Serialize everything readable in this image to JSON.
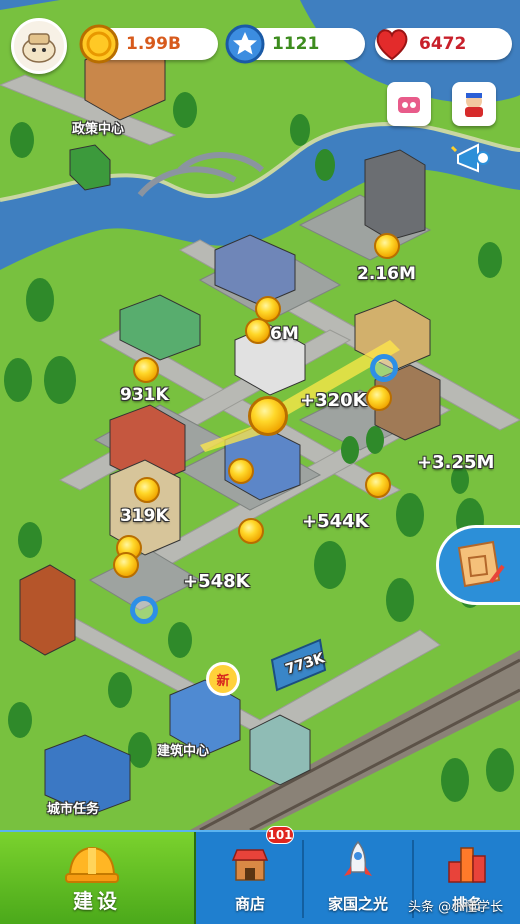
{
  "resources": {
    "gold": "1.99B",
    "stars": "1121",
    "hearts": "6472"
  },
  "map_labels": {
    "policy_center": "政策中心",
    "construction_center": "建筑中心",
    "city_tasks": "城市任务",
    "new_badge": "新",
    "billboard": "773K"
  },
  "income": {
    "factory": "2.16M",
    "plant_partial": "6M",
    "shop_left": "931K",
    "center_big": "+320K",
    "right": "+3.25M",
    "mid_left": "319K",
    "garden": "+544K",
    "bottom": "+548K"
  },
  "nav": {
    "build": "建设",
    "shop": "商店",
    "shop_badge": "101",
    "country": "家国之光",
    "rank": "排名"
  },
  "watermark": "头条 @小懂学长",
  "colors": {
    "grass": "#6fb83a",
    "river": "#3f7fc0",
    "nav": "#1f7fcf",
    "nav_active": "#6cc628"
  }
}
